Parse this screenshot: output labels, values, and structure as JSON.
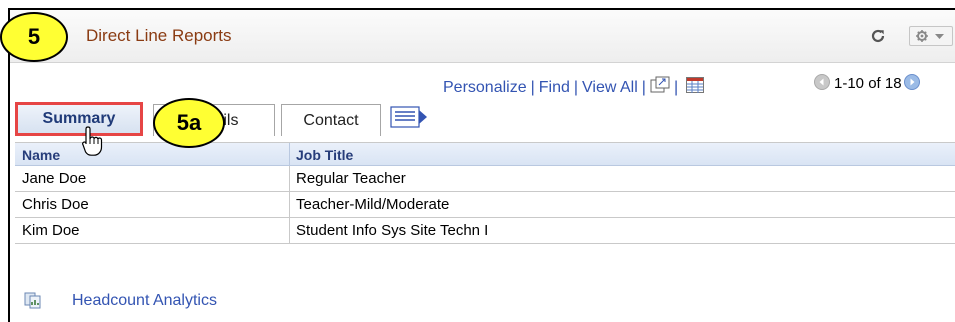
{
  "pagelet": {
    "title": "Direct Line Reports",
    "refresh_icon": "refresh-icon",
    "settings_icon": "gear-icon"
  },
  "callouts": {
    "step5": "5",
    "step5a": "5a"
  },
  "nav": {
    "personalize": "Personalize",
    "find": "Find",
    "view_all": "View All",
    "separator": "|",
    "pager_text": "1-10 of 18"
  },
  "tabs": {
    "summary": "Summary",
    "details": "Details",
    "contact": "Contact"
  },
  "grid": {
    "columns": [
      "Name",
      "Job Title"
    ],
    "rows": [
      {
        "name": "Jane Doe",
        "job_title": "Regular Teacher"
      },
      {
        "name": "Chris Doe",
        "job_title": "Teacher-Mild/Moderate"
      },
      {
        "name": "Kim Doe",
        "job_title": "Student Info Sys Site Techn I"
      }
    ]
  },
  "links": {
    "headcount_analytics": "Headcount Analytics"
  },
  "colors": {
    "title": "#8a3b12",
    "link": "#3354b2",
    "callout": "#ffff33",
    "active_tab_border": "#e64545"
  }
}
